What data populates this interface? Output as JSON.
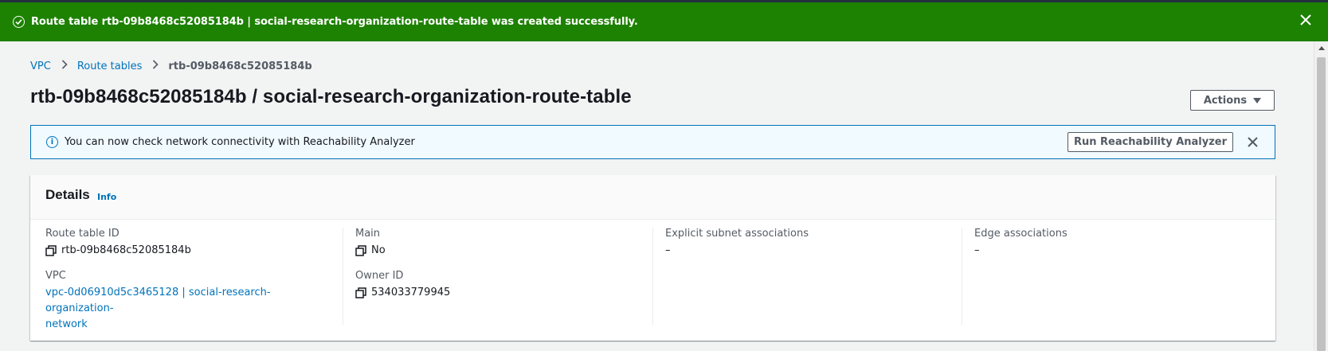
{
  "flash": {
    "message": "Route table rtb-09b8468c52085184b | social-research-organization-route-table was created successfully."
  },
  "breadcrumb": {
    "items": [
      "VPC",
      "Route tables"
    ],
    "current": "rtb-09b8468c52085184b"
  },
  "page": {
    "title": "rtb-09b8468c52085184b / social-research-organization-route-table",
    "actions_label": "Actions"
  },
  "alert": {
    "message": "You can now check network connectivity with Reachability Analyzer",
    "button_label": "Run Reachability Analyzer"
  },
  "details": {
    "title": "Details",
    "info_label": "Info",
    "route_table_id_label": "Route table ID",
    "route_table_id": "rtb-09b8468c52085184b",
    "vpc_label": "VPC",
    "vpc_link_line1": "vpc-0d06910d5c3465128 | social-research-organization-",
    "vpc_link_line2": "network",
    "main_label": "Main",
    "main_value": "No",
    "owner_id_label": "Owner ID",
    "owner_id": "534033779945",
    "explicit_label": "Explicit subnet associations",
    "explicit_value": "–",
    "edge_label": "Edge associations",
    "edge_value": "–"
  },
  "colors": {
    "success": "#1d8102",
    "link": "#0073bb",
    "info_bg": "#f1faff",
    "page_bg": "#f2f3f3"
  }
}
